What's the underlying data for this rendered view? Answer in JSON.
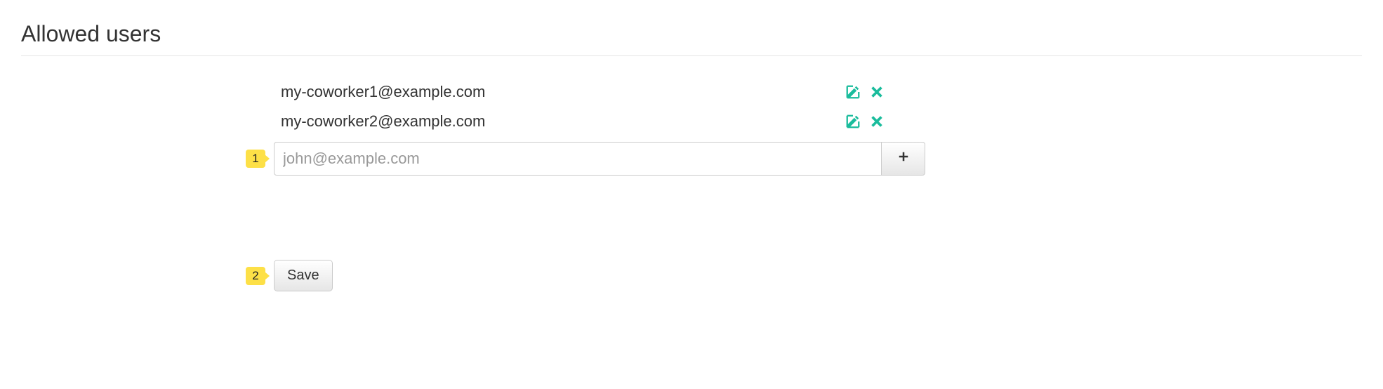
{
  "section": {
    "title": "Allowed users"
  },
  "users": [
    {
      "email": "my-coworker1@example.com"
    },
    {
      "email": "my-coworker2@example.com"
    }
  ],
  "input": {
    "placeholder": "john@example.com"
  },
  "callouts": {
    "input": "1",
    "save": "2"
  },
  "buttons": {
    "save": "Save"
  },
  "colors": {
    "accent": "#1abc9c",
    "callout": "#fde047"
  }
}
